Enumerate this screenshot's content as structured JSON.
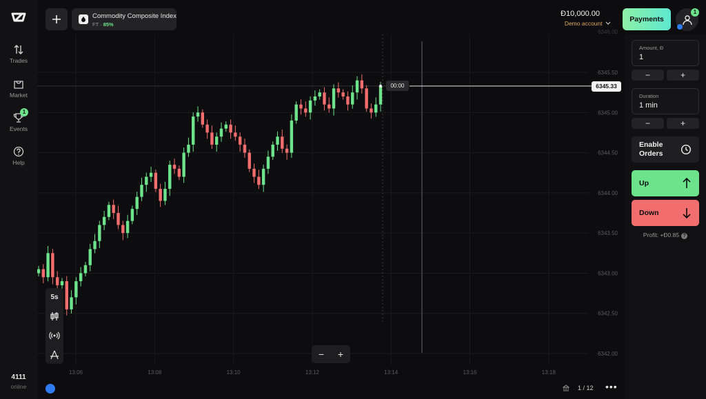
{
  "sidebar": {
    "items": [
      {
        "label": "Trades",
        "icon": "arrows-up-down-icon"
      },
      {
        "label": "Market",
        "icon": "basket-icon"
      },
      {
        "label": "Events",
        "icon": "trophy-icon",
        "badge": "1"
      },
      {
        "label": "Help",
        "icon": "question-circle-icon"
      }
    ],
    "online_count": "4111",
    "online_label": "online"
  },
  "header": {
    "asset_name": "Commodity Composite Index",
    "asset_type": "FT",
    "asset_payout": "85%",
    "balance": "Đ10,000.00",
    "account": "Demo account",
    "payments_label": "Payments",
    "avatar_badge": "1"
  },
  "chart": {
    "current_price": "6345.33",
    "timer": "00:00",
    "candle_interval": "5s",
    "page_indicator": "1 / 12"
  },
  "chart_data": {
    "type": "candlestick",
    "y_ticks": [
      "6345.50",
      "6345.00",
      "6344.50",
      "6344.00",
      "6343.50",
      "6343.00",
      "6342.50",
      "6342.00"
    ],
    "y_tick_values": [
      6345.5,
      6345.0,
      6344.5,
      6344.0,
      6343.5,
      6343.0,
      6342.5,
      6342.0
    ],
    "x_ticks": [
      "13:06",
      "13:08",
      "13:10",
      "13:12",
      "13:14",
      "13:16",
      "13:18"
    ],
    "current_price": 6345.33,
    "close_values": [
      6343.05,
      6342.95,
      6343.25,
      6342.95,
      6342.85,
      6342.9,
      6342.55,
      6342.7,
      6342.9,
      6343.0,
      6343.1,
      6343.3,
      6343.4,
      6343.6,
      6343.7,
      6343.85,
      6343.75,
      6343.6,
      6343.5,
      6343.65,
      6343.8,
      6343.95,
      6344.1,
      6344.2,
      6344.25,
      6344.05,
      6343.9,
      6344.05,
      6344.35,
      6344.3,
      6344.2,
      6344.5,
      6344.6,
      6344.95,
      6345.0,
      6344.85,
      6344.75,
      6344.6,
      6344.7,
      6344.8,
      6344.85,
      6344.75,
      6344.7,
      6344.6,
      6344.5,
      6344.3,
      6344.2,
      6344.1,
      6344.3,
      6344.45,
      6344.6,
      6344.7,
      6344.55,
      6344.5,
      6344.9,
      6345.1,
      6345.05,
      6345.0,
      6345.15,
      6345.2,
      6345.25,
      6345.1,
      6345.05,
      6345.3,
      6345.25,
      6345.2,
      6345.1,
      6345.25,
      6345.4,
      6345.3,
      6345.05,
      6345.0,
      6345.1,
      6345.33
    ]
  },
  "panel": {
    "amount_label": "Amount, Đ",
    "amount_value": "1",
    "duration_label": "Duration",
    "duration_value": "1 min",
    "enable_orders": "Enable Orders",
    "up_label": "Up",
    "down_label": "Down",
    "profit": "Profit: +Đ0.85",
    "minus": "−",
    "plus": "+",
    "colors": {
      "up": "#6de38c",
      "down": "#f26d6d"
    }
  }
}
